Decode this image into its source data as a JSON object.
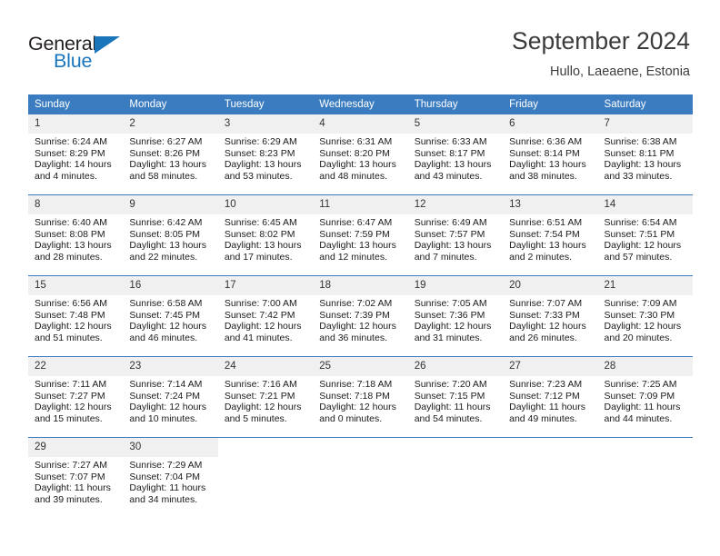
{
  "brand": {
    "name_top": "General",
    "name_bottom": "Blue",
    "accent_color": "#1b75bb",
    "logo_icon": "triangle-logo-icon"
  },
  "header": {
    "title": "September 2024",
    "subtitle": "Hullo, Laeaene, Estonia"
  },
  "theme": {
    "header_row_bg": "#3a7cbf",
    "daynum_bg": "#f0f0f0",
    "row_separator": "#3a7cbf",
    "text": "#1a1a1a"
  },
  "weekdays": [
    "Sunday",
    "Monday",
    "Tuesday",
    "Wednesday",
    "Thursday",
    "Friday",
    "Saturday"
  ],
  "weeks": [
    [
      {
        "day": "1",
        "sunrise": "Sunrise: 6:24 AM",
        "sunset": "Sunset: 8:29 PM",
        "daylight_1": "Daylight: 14 hours",
        "daylight_2": "and 4 minutes."
      },
      {
        "day": "2",
        "sunrise": "Sunrise: 6:27 AM",
        "sunset": "Sunset: 8:26 PM",
        "daylight_1": "Daylight: 13 hours",
        "daylight_2": "and 58 minutes."
      },
      {
        "day": "3",
        "sunrise": "Sunrise: 6:29 AM",
        "sunset": "Sunset: 8:23 PM",
        "daylight_1": "Daylight: 13 hours",
        "daylight_2": "and 53 minutes."
      },
      {
        "day": "4",
        "sunrise": "Sunrise: 6:31 AM",
        "sunset": "Sunset: 8:20 PM",
        "daylight_1": "Daylight: 13 hours",
        "daylight_2": "and 48 minutes."
      },
      {
        "day": "5",
        "sunrise": "Sunrise: 6:33 AM",
        "sunset": "Sunset: 8:17 PM",
        "daylight_1": "Daylight: 13 hours",
        "daylight_2": "and 43 minutes."
      },
      {
        "day": "6",
        "sunrise": "Sunrise: 6:36 AM",
        "sunset": "Sunset: 8:14 PM",
        "daylight_1": "Daylight: 13 hours",
        "daylight_2": "and 38 minutes."
      },
      {
        "day": "7",
        "sunrise": "Sunrise: 6:38 AM",
        "sunset": "Sunset: 8:11 PM",
        "daylight_1": "Daylight: 13 hours",
        "daylight_2": "and 33 minutes."
      }
    ],
    [
      {
        "day": "8",
        "sunrise": "Sunrise: 6:40 AM",
        "sunset": "Sunset: 8:08 PM",
        "daylight_1": "Daylight: 13 hours",
        "daylight_2": "and 28 minutes."
      },
      {
        "day": "9",
        "sunrise": "Sunrise: 6:42 AM",
        "sunset": "Sunset: 8:05 PM",
        "daylight_1": "Daylight: 13 hours",
        "daylight_2": "and 22 minutes."
      },
      {
        "day": "10",
        "sunrise": "Sunrise: 6:45 AM",
        "sunset": "Sunset: 8:02 PM",
        "daylight_1": "Daylight: 13 hours",
        "daylight_2": "and 17 minutes."
      },
      {
        "day": "11",
        "sunrise": "Sunrise: 6:47 AM",
        "sunset": "Sunset: 7:59 PM",
        "daylight_1": "Daylight: 13 hours",
        "daylight_2": "and 12 minutes."
      },
      {
        "day": "12",
        "sunrise": "Sunrise: 6:49 AM",
        "sunset": "Sunset: 7:57 PM",
        "daylight_1": "Daylight: 13 hours",
        "daylight_2": "and 7 minutes."
      },
      {
        "day": "13",
        "sunrise": "Sunrise: 6:51 AM",
        "sunset": "Sunset: 7:54 PM",
        "daylight_1": "Daylight: 13 hours",
        "daylight_2": "and 2 minutes."
      },
      {
        "day": "14",
        "sunrise": "Sunrise: 6:54 AM",
        "sunset": "Sunset: 7:51 PM",
        "daylight_1": "Daylight: 12 hours",
        "daylight_2": "and 57 minutes."
      }
    ],
    [
      {
        "day": "15",
        "sunrise": "Sunrise: 6:56 AM",
        "sunset": "Sunset: 7:48 PM",
        "daylight_1": "Daylight: 12 hours",
        "daylight_2": "and 51 minutes."
      },
      {
        "day": "16",
        "sunrise": "Sunrise: 6:58 AM",
        "sunset": "Sunset: 7:45 PM",
        "daylight_1": "Daylight: 12 hours",
        "daylight_2": "and 46 minutes."
      },
      {
        "day": "17",
        "sunrise": "Sunrise: 7:00 AM",
        "sunset": "Sunset: 7:42 PM",
        "daylight_1": "Daylight: 12 hours",
        "daylight_2": "and 41 minutes."
      },
      {
        "day": "18",
        "sunrise": "Sunrise: 7:02 AM",
        "sunset": "Sunset: 7:39 PM",
        "daylight_1": "Daylight: 12 hours",
        "daylight_2": "and 36 minutes."
      },
      {
        "day": "19",
        "sunrise": "Sunrise: 7:05 AM",
        "sunset": "Sunset: 7:36 PM",
        "daylight_1": "Daylight: 12 hours",
        "daylight_2": "and 31 minutes."
      },
      {
        "day": "20",
        "sunrise": "Sunrise: 7:07 AM",
        "sunset": "Sunset: 7:33 PM",
        "daylight_1": "Daylight: 12 hours",
        "daylight_2": "and 26 minutes."
      },
      {
        "day": "21",
        "sunrise": "Sunrise: 7:09 AM",
        "sunset": "Sunset: 7:30 PM",
        "daylight_1": "Daylight: 12 hours",
        "daylight_2": "and 20 minutes."
      }
    ],
    [
      {
        "day": "22",
        "sunrise": "Sunrise: 7:11 AM",
        "sunset": "Sunset: 7:27 PM",
        "daylight_1": "Daylight: 12 hours",
        "daylight_2": "and 15 minutes."
      },
      {
        "day": "23",
        "sunrise": "Sunrise: 7:14 AM",
        "sunset": "Sunset: 7:24 PM",
        "daylight_1": "Daylight: 12 hours",
        "daylight_2": "and 10 minutes."
      },
      {
        "day": "24",
        "sunrise": "Sunrise: 7:16 AM",
        "sunset": "Sunset: 7:21 PM",
        "daylight_1": "Daylight: 12 hours",
        "daylight_2": "and 5 minutes."
      },
      {
        "day": "25",
        "sunrise": "Sunrise: 7:18 AM",
        "sunset": "Sunset: 7:18 PM",
        "daylight_1": "Daylight: 12 hours",
        "daylight_2": "and 0 minutes."
      },
      {
        "day": "26",
        "sunrise": "Sunrise: 7:20 AM",
        "sunset": "Sunset: 7:15 PM",
        "daylight_1": "Daylight: 11 hours",
        "daylight_2": "and 54 minutes."
      },
      {
        "day": "27",
        "sunrise": "Sunrise: 7:23 AM",
        "sunset": "Sunset: 7:12 PM",
        "daylight_1": "Daylight: 11 hours",
        "daylight_2": "and 49 minutes."
      },
      {
        "day": "28",
        "sunrise": "Sunrise: 7:25 AM",
        "sunset": "Sunset: 7:09 PM",
        "daylight_1": "Daylight: 11 hours",
        "daylight_2": "and 44 minutes."
      }
    ],
    [
      {
        "day": "29",
        "sunrise": "Sunrise: 7:27 AM",
        "sunset": "Sunset: 7:07 PM",
        "daylight_1": "Daylight: 11 hours",
        "daylight_2": "and 39 minutes."
      },
      {
        "day": "30",
        "sunrise": "Sunrise: 7:29 AM",
        "sunset": "Sunset: 7:04 PM",
        "daylight_1": "Daylight: 11 hours",
        "daylight_2": "and 34 minutes."
      },
      {
        "day": "",
        "sunrise": "",
        "sunset": "",
        "daylight_1": "",
        "daylight_2": ""
      },
      {
        "day": "",
        "sunrise": "",
        "sunset": "",
        "daylight_1": "",
        "daylight_2": ""
      },
      {
        "day": "",
        "sunrise": "",
        "sunset": "",
        "daylight_1": "",
        "daylight_2": ""
      },
      {
        "day": "",
        "sunrise": "",
        "sunset": "",
        "daylight_1": "",
        "daylight_2": ""
      },
      {
        "day": "",
        "sunrise": "",
        "sunset": "",
        "daylight_1": "",
        "daylight_2": ""
      }
    ]
  ]
}
